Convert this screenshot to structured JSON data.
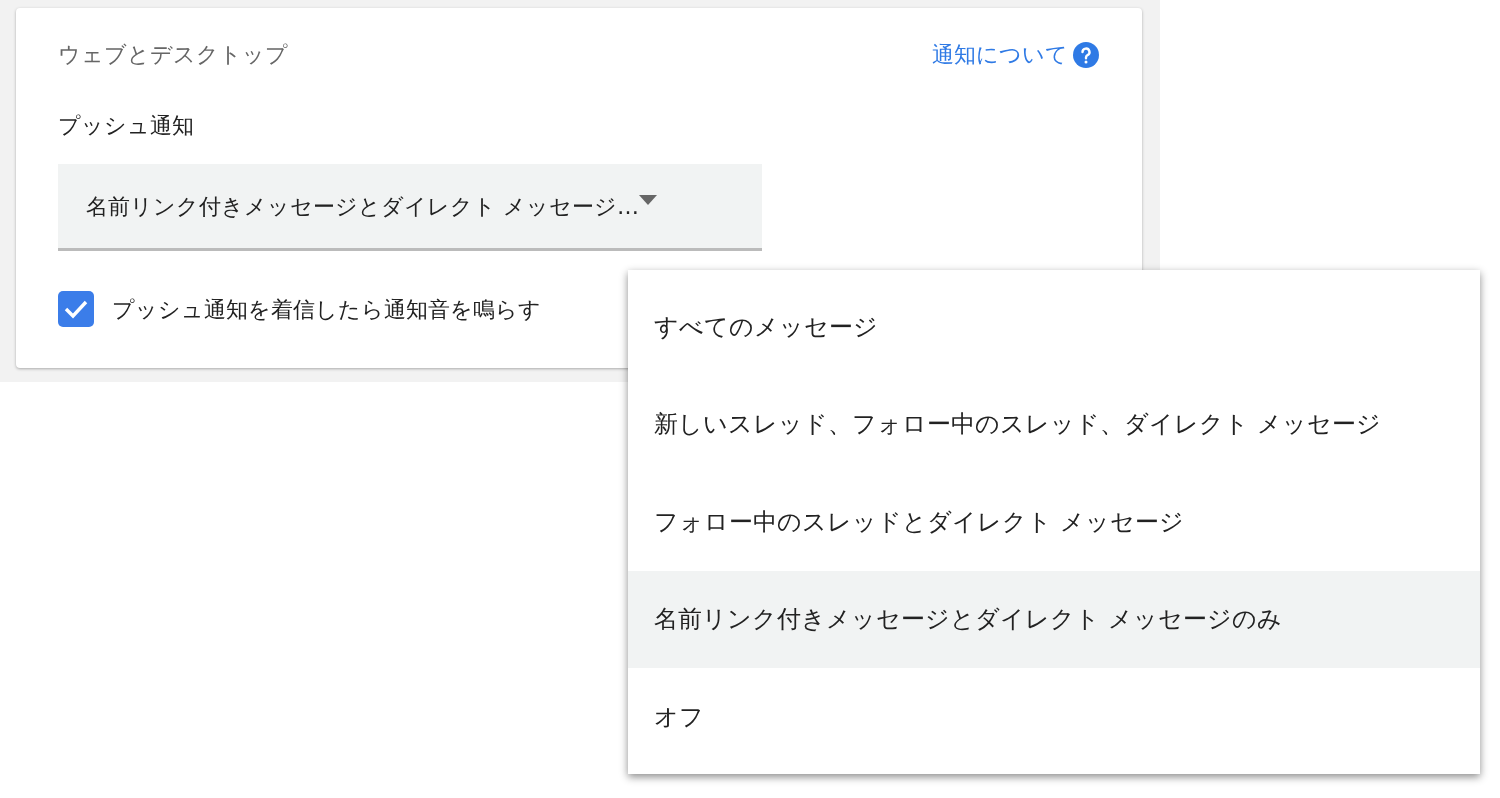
{
  "section": {
    "title": "ウェブとデスクトップ",
    "help_link": "通知について"
  },
  "push": {
    "label": "プッシュ通知",
    "value": "名前リンク付きメッセージとダイレクト メッセージ…"
  },
  "sound_checkbox": {
    "label": "プッシュ通知を着信したら通知音を鳴らす",
    "checked": true
  },
  "menu": [
    {
      "label": "すべてのメッセージ",
      "selected": false
    },
    {
      "label": "新しいスレッド、フォロー中のスレッド、ダイレクト メッセージ",
      "selected": false
    },
    {
      "label": "フォロー中のスレッドとダイレクト メッセージ",
      "selected": false
    },
    {
      "label": "名前リンク付きメッセージとダイレクト メッセージのみ",
      "selected": true
    },
    {
      "label": "オフ",
      "selected": false
    }
  ]
}
